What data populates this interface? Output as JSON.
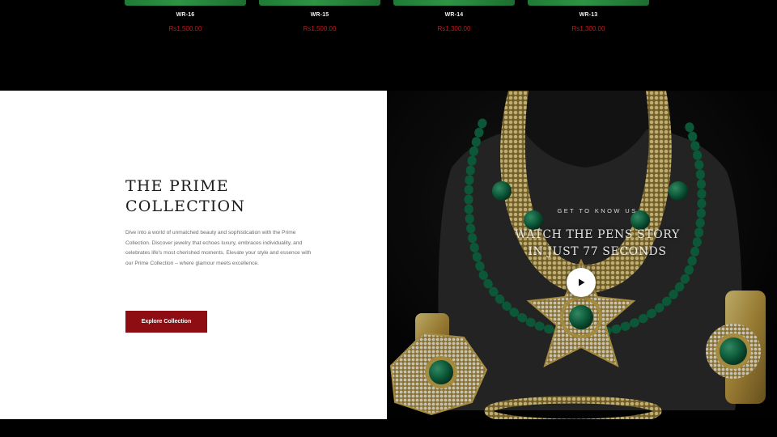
{
  "products": [
    {
      "code": "WR-16",
      "price": "Rs1,500.00"
    },
    {
      "code": "WR-15",
      "price": "Rs1,500.00"
    },
    {
      "code": "WR-14",
      "price": "Rs1,300.00"
    },
    {
      "code": "WR-13",
      "price": "Rs1,300.00"
    }
  ],
  "prime": {
    "title_line1": "THE PRIME",
    "title_line2": "COLLECTION",
    "description": "Dive into a world of unmatched beauty and sophistication with the Prime Collection. Discover jewelry that echoes luxury, embraces individuality, and celebrates life's most cherished moments. Elevate your style and essence with our Prime Collection – where glamour meets excellence.",
    "cta_label": "Explore Collection"
  },
  "video": {
    "eyebrow": "GET TO KNOW US",
    "headline_line1": "WATCH THE PENS STORY",
    "headline_line2": "IN JUST 77 SECONDS",
    "play_icon": "play-icon"
  },
  "colors": {
    "accent": "#8e0d12",
    "price": "#c01818",
    "emerald": "#0f6b45",
    "gold": "#c9a94c"
  }
}
